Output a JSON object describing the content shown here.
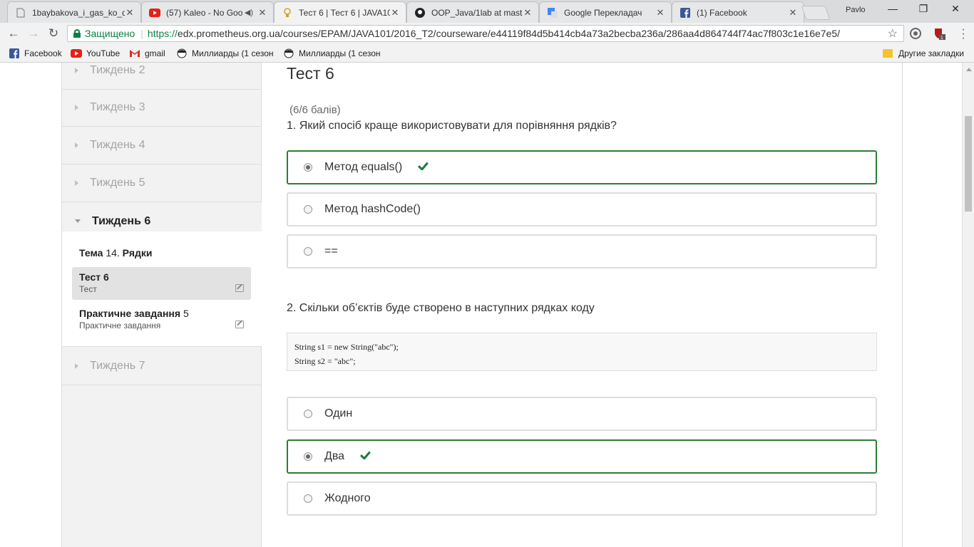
{
  "browser": {
    "tabs": [
      {
        "title": "1baybakova_i_gas_ko_d",
        "icon": "document-icon"
      },
      {
        "title": "(57) Kaleo - No Goo",
        "icon": "youtube-icon"
      },
      {
        "title": "Тест 6 | Тест 6 | JAVA10",
        "icon": "prometheus-icon"
      },
      {
        "title": "OOP_Java/1lab at mast",
        "icon": "github-icon"
      },
      {
        "title": "Google Перекладач",
        "icon": "google-translate-icon"
      },
      {
        "title": "(1) Facebook",
        "icon": "facebook-icon"
      }
    ],
    "profile": "Pavlo",
    "address": {
      "secure_label": "Защищено",
      "url_protocol": "https://",
      "url_rest": "edx.prometheus.org.ua/courses/EPAM/JAVA101/2016_T2/courseware/e44119f84d5b414cb4a73a2becba236a/286aa4d864744f74ac7f803c1e16e7e5/"
    },
    "bookmarks": [
      {
        "label": "Facebook",
        "icon": "facebook-icon"
      },
      {
        "label": "YouTube",
        "icon": "youtube-icon"
      },
      {
        "label": "gmail",
        "icon": "gmail-icon"
      },
      {
        "label": "Миллиарды (1 сезон",
        "icon": "avatar-icon"
      },
      {
        "label": "Миллиарды (1 сезон",
        "icon": "avatar-icon"
      }
    ],
    "other_bookmarks": "Другие закладки",
    "extension_badge": "1"
  },
  "sidebar": {
    "weeks": [
      {
        "label": "Тиждень 2"
      },
      {
        "label": "Тиждень 3"
      },
      {
        "label": "Тиждень 4"
      },
      {
        "label": "Тиждень 5"
      },
      {
        "label": "Тиждень 6"
      },
      {
        "label": "Тиждень 7"
      }
    ],
    "topic": {
      "prefix": "Тема",
      "num": "14.",
      "name": "Рядки"
    },
    "subsections": [
      {
        "title": "Тест 6",
        "num": "",
        "subtitle": "Тест"
      },
      {
        "title": "Практичне завдання",
        "num": "5",
        "subtitle": "Практичне завдання"
      }
    ]
  },
  "main": {
    "title": "Тест 6",
    "score": "(6/6 балів)",
    "q1": {
      "text": "1. Який спосіб краще використовувати для порівняння рядків?",
      "choices": [
        "Метод equals()",
        "Метод hashCode()",
        "=="
      ],
      "selected": 0
    },
    "q2": {
      "text": "2. Скільки об’єктів буде створено в наступних рядках коду",
      "code": [
        "String s1 = new String(\"abc\");",
        "String s2 = \"abc\";"
      ],
      "choices": [
        "Один",
        "Два",
        "Жодного"
      ],
      "selected": 1
    }
  }
}
